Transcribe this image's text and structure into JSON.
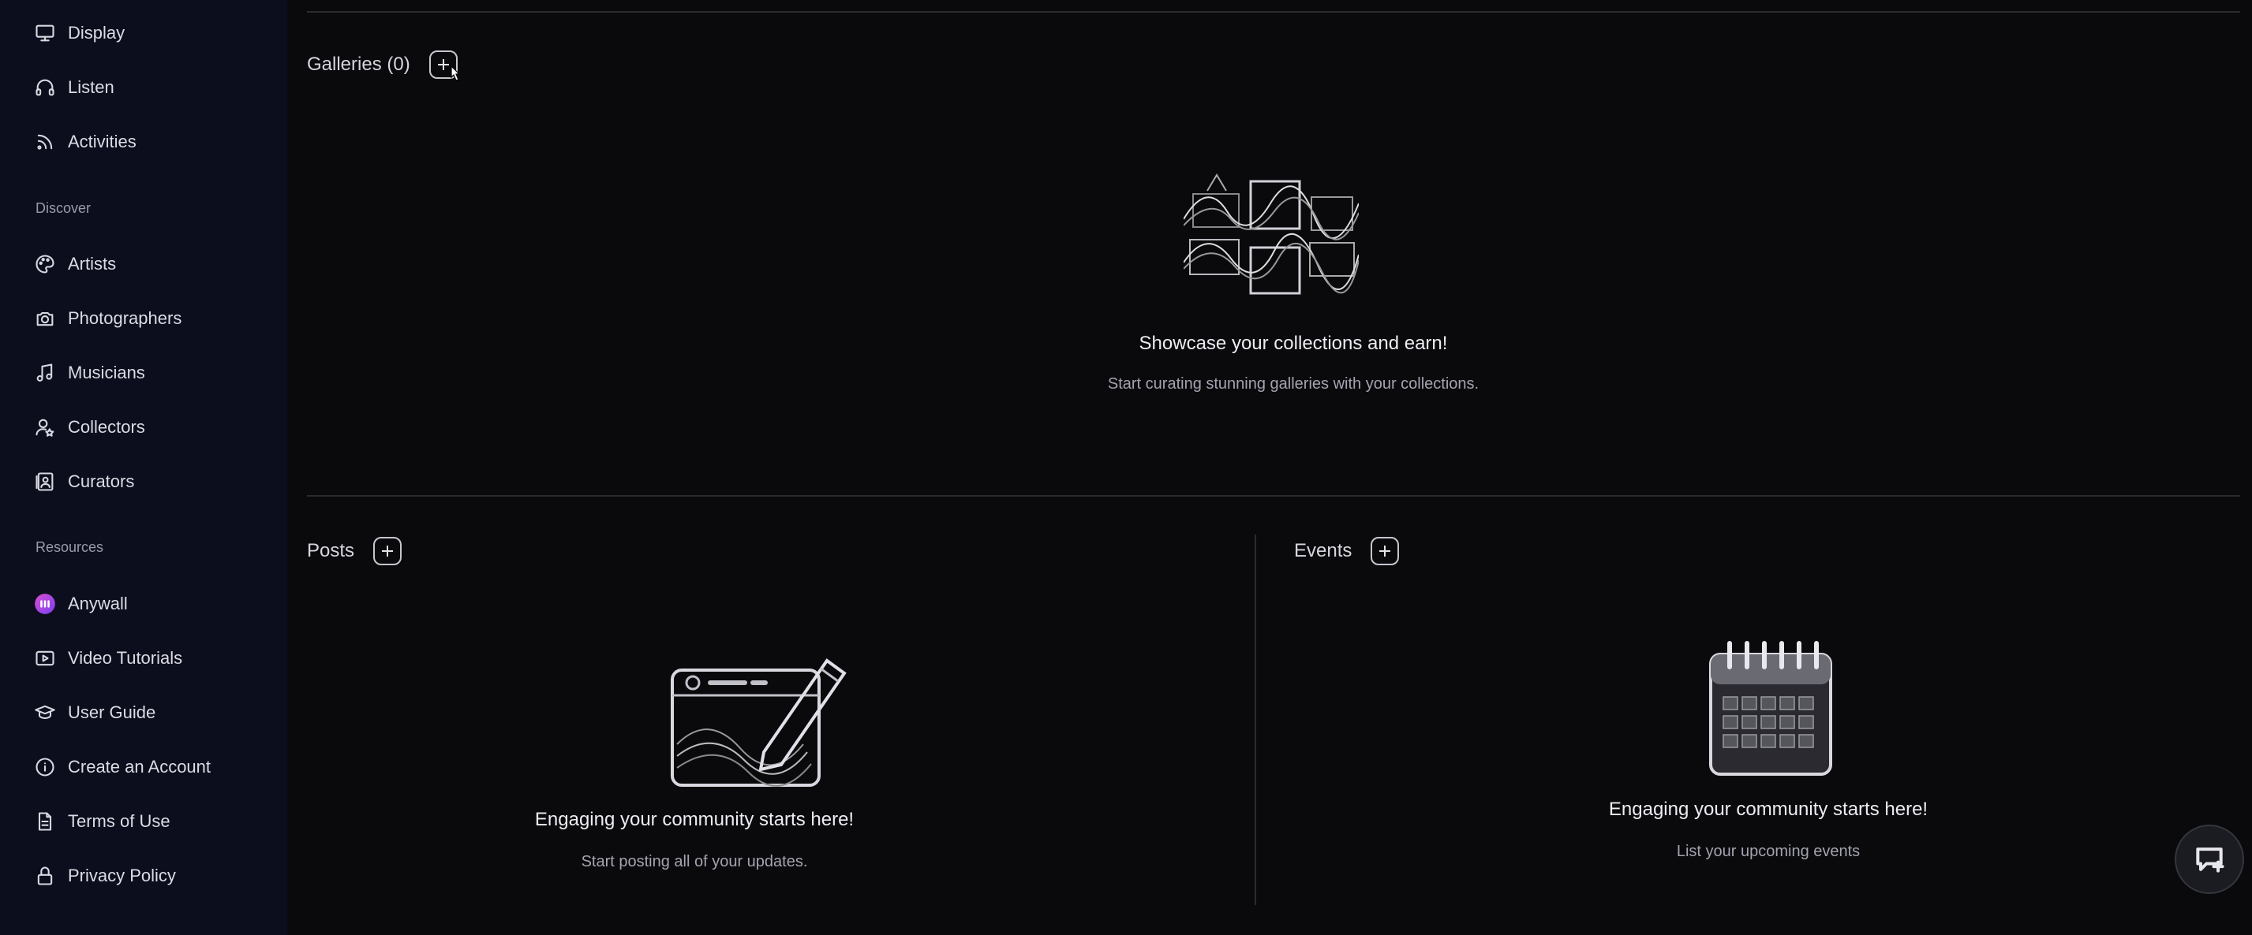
{
  "sidebar": {
    "top_items": [
      {
        "label": "Display",
        "icon": "monitor-icon"
      },
      {
        "label": "Listen",
        "icon": "headphones-icon"
      },
      {
        "label": "Activities",
        "icon": "rss-icon"
      }
    ],
    "discover_title": "Discover",
    "discover_items": [
      {
        "label": "Artists",
        "icon": "palette-icon"
      },
      {
        "label": "Photographers",
        "icon": "camera-icon"
      },
      {
        "label": "Musicians",
        "icon": "music-note-icon"
      },
      {
        "label": "Collectors",
        "icon": "user-star-icon"
      },
      {
        "label": "Curators",
        "icon": "id-card-icon"
      }
    ],
    "resources_title": "Resources",
    "resources_items": [
      {
        "label": "Anywall",
        "icon": "anywall-logo-icon"
      },
      {
        "label": "Video Tutorials",
        "icon": "play-box-icon"
      },
      {
        "label": "User Guide",
        "icon": "graduation-cap-icon"
      },
      {
        "label": "Create an Account",
        "icon": "info-icon"
      },
      {
        "label": "Terms of Use",
        "icon": "document-icon"
      },
      {
        "label": "Privacy Policy",
        "icon": "lock-icon"
      }
    ]
  },
  "galleries": {
    "title": "Galleries (0)",
    "empty_title": "Showcase your collections and earn!",
    "empty_sub": "Start curating stunning galleries with your collections."
  },
  "posts": {
    "title": "Posts",
    "empty_title": "Engaging your community starts here!",
    "empty_sub": "Start posting all of your updates."
  },
  "events": {
    "title": "Events",
    "empty_title": "Engaging your community starts here!",
    "empty_sub": "List your upcoming events"
  },
  "colors": {
    "sidebar_bg": "#0c0e1e",
    "main_bg": "#0a0a0d",
    "anywall_pink": "#d84fd0",
    "anywall_purple": "#7b3ff2"
  }
}
